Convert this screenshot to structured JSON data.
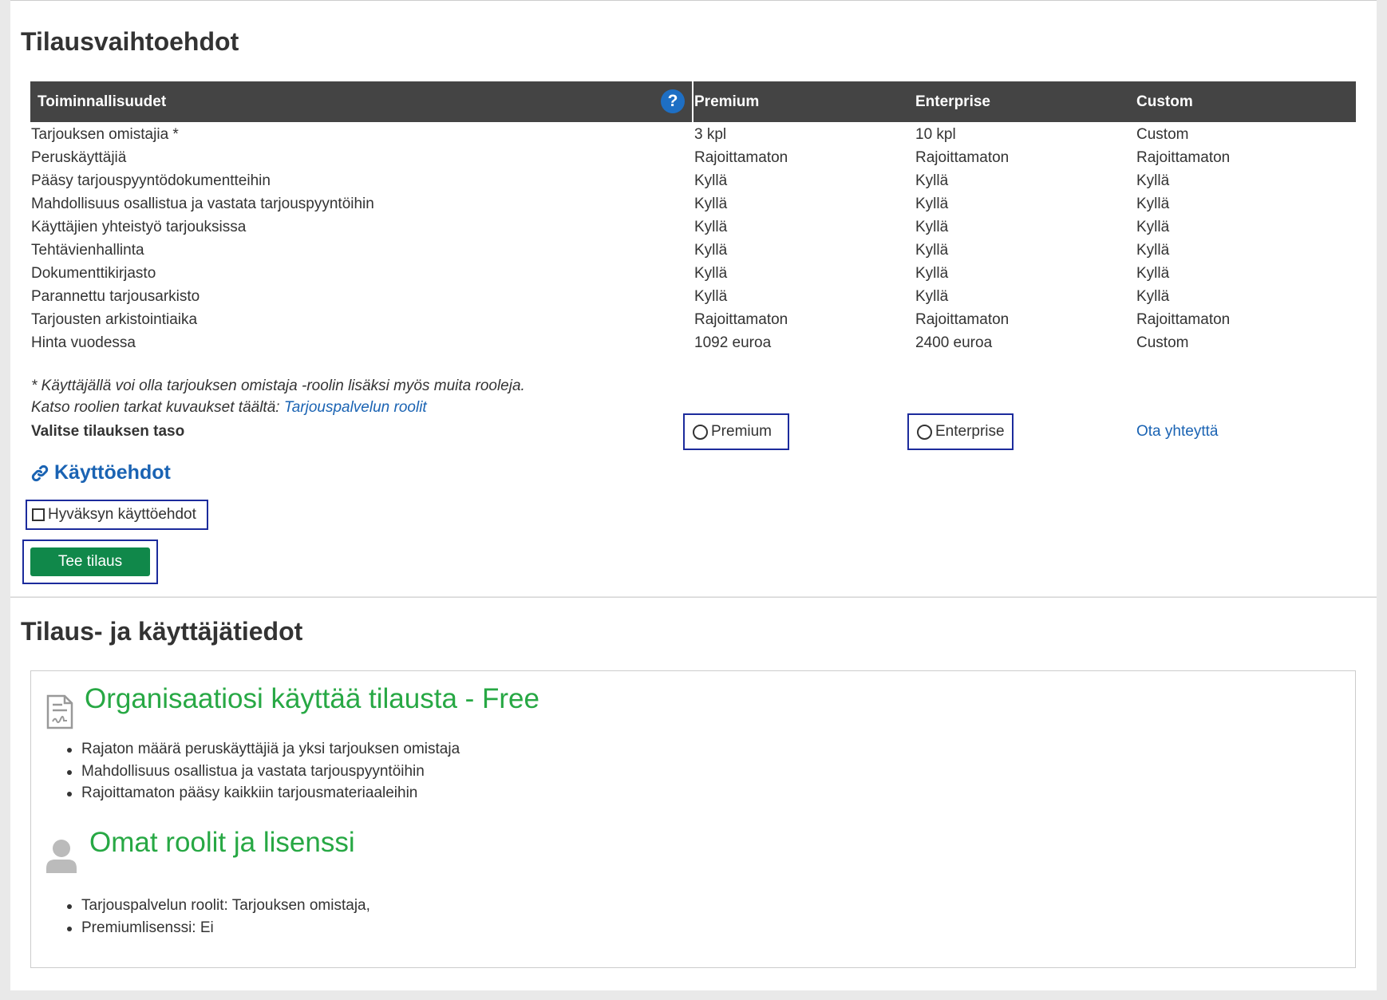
{
  "section1": {
    "title": "Tilausvaihtoehdot",
    "table": {
      "headers": [
        "Toiminnallisuudet",
        "Premium",
        "Enterprise",
        "Custom"
      ],
      "help_icon_glyph": "?",
      "rows": [
        [
          "Tarjouksen omistajia *",
          "3 kpl",
          "10 kpl",
          "Custom"
        ],
        [
          "Peruskäyttäjiä",
          "Rajoittamaton",
          "Rajoittamaton",
          "Rajoittamaton"
        ],
        [
          "Pääsy tarjouspyyntödokumentteihin",
          "Kyllä",
          "Kyllä",
          "Kyllä"
        ],
        [
          "Mahdollisuus osallistua ja vastata tarjouspyyntöihin",
          "Kyllä",
          "Kyllä",
          "Kyllä"
        ],
        [
          "Käyttäjien yhteistyö tarjouksissa",
          "Kyllä",
          "Kyllä",
          "Kyllä"
        ],
        [
          "Tehtävienhallinta",
          "Kyllä",
          "Kyllä",
          "Kyllä"
        ],
        [
          "Dokumenttikirjasto",
          "Kyllä",
          "Kyllä",
          "Kyllä"
        ],
        [
          "Parannettu tarjousarkisto",
          "Kyllä",
          "Kyllä",
          "Kyllä"
        ],
        [
          "Tarjousten arkistointiaika",
          "Rajoittamaton",
          "Rajoittamaton",
          "Rajoittamaton"
        ],
        [
          "Hinta vuodessa",
          "1092 euroa",
          "2400 euroa",
          "Custom"
        ]
      ]
    },
    "note_line1": "* Käyttäjällä voi olla tarjouksen omistaja -roolin lisäksi myös muita rooleja.",
    "note_line2_prefix": "Katso roolien tarkat kuvaukset täältä:",
    "note_link": "Tarjouspalvelun roolit",
    "select_label": "Valitse tilauksen taso",
    "radio_premium": "Premium",
    "radio_enterprise": "Enterprise",
    "contact_link": "Ota yhteyttä",
    "terms_link": "Käyttöehdot",
    "accept_terms": "Hyväksyn käyttöehdot",
    "submit_button": "Tee tilaus"
  },
  "section2": {
    "title": "Tilaus- ja käyttäjätiedot",
    "subscription_heading": "Organisaatiosi käyttää tilausta - Free",
    "subscription_items": [
      "Rajaton määrä peruskäyttäjiä ja yksi tarjouksen omistaja",
      "Mahdollisuus osallistua ja vastata tarjouspyyntöihin",
      "Rajoittamaton pääsy kaikkiin tarjousmateriaaleihin"
    ],
    "roles_heading": "Omat roolit ja lisenssi",
    "roles_items": [
      "Tarjouspalvelun roolit: Tarjouksen omistaja,",
      "Premiumlisenssi: Ei"
    ]
  },
  "colors": {
    "header_bg": "#444444",
    "link": "#1a63b3",
    "green_heading": "#27a844",
    "button_green": "#10884a",
    "focus_outline": "#1c2b9c",
    "help_icon": "#1e6fc4"
  },
  "icons": [
    "help-icon",
    "link-icon",
    "document-icon",
    "user-icon"
  ]
}
